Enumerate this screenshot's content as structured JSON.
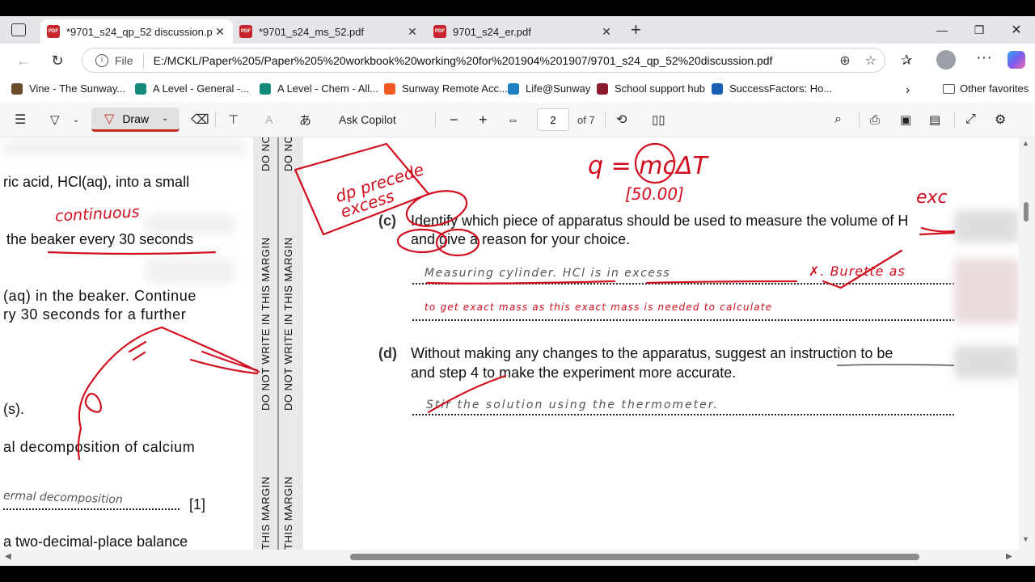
{
  "tabs": [
    {
      "title": "*9701_s24_qp_52 discussion.pdf",
      "active": true
    },
    {
      "title": "*9701_s24_ms_52.pdf",
      "active": false
    },
    {
      "title": "9701_s24_er.pdf",
      "active": false
    }
  ],
  "address": {
    "scheme_label": "File",
    "url": "E:/MCKL/Paper%205/Paper%205%20workbook%20working%20for%201904%201907/9701_s24_qp_52%20discussion.pdf"
  },
  "favorites": [
    {
      "label": "Vine - The Sunway...",
      "color": "#6b4a2b"
    },
    {
      "label": "A Level - General -...",
      "color": "#138a7a"
    },
    {
      "label": "A Level - Chem - All...",
      "color": "#138a7a"
    },
    {
      "label": "Sunway Remote Acc...",
      "color": "#f05a22"
    },
    {
      "label": "Life@Sunway",
      "color": "#1d7fc1"
    },
    {
      "label": "School support hub",
      "color": "#8b1a2e"
    },
    {
      "label": "SuccessFactors: Ho...",
      "color": "#1a5fb4"
    }
  ],
  "other_favorites": "Other favorites",
  "pdf_toolbar": {
    "draw": "Draw",
    "ask_copilot": "Ask Copilot",
    "page": "2",
    "of_pages": "of 7"
  },
  "left_page": {
    "lines": [
      "ric acid, HCl(aq), into a small",
      "the beaker every 30 seconds",
      "(aq) in the beaker. Continue",
      "ry 30 seconds for a further",
      "(s).",
      "al decomposition of calcium",
      "[1]",
      "a two-decimal-place balance"
    ],
    "handwriting": [
      "continuous",
      "ermal decomposition"
    ]
  },
  "margin_text": [
    "DO NOT WRITE IN THIS MARGIN",
    "DO NOT WRITE IN THIS MARGIN",
    "DO NOT",
    "DO NOT",
    "THIS MARGIN",
    "THIS MARGIN"
  ],
  "question_c": {
    "label": "(c)",
    "line1": "Identify which piece of apparatus should be used to measure the volume of H",
    "line2": "and give a reason for your choice."
  },
  "question_d": {
    "label": "(d)",
    "line1": "Without making any changes to the apparatus, suggest an instruction to be",
    "line2": "and step 4 to make the experiment more accurate."
  },
  "handwriting_right": {
    "box_note": "dp precede excess",
    "formula": "q = mcΔT",
    "formula_note": "[50.00]",
    "exc": "exc",
    "answer_c1": "Measuring cylinder. HCl is in excess",
    "answer_c1_extra": "✗. Burette as",
    "answer_c2": "to get exact mass as this exact mass is needed to calculate",
    "answer_d": "Stir the solution using the thermometer."
  },
  "colors": {
    "ink_red": "#d10e1e",
    "ink_gray": "#555555"
  }
}
